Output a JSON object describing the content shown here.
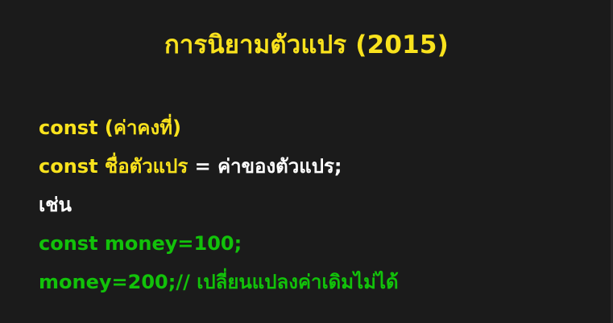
{
  "slide": {
    "title": "การนิยามตัวแปร (2015)",
    "lines": [
      {
        "keyword": "const (ค่าคงที่)"
      },
      {
        "keyword": "const ชื่อตัวแปร",
        "rest": " = ค่าของตัวแปร;"
      },
      {
        "text": "เช่น"
      },
      {
        "code": "const money=100;"
      },
      {
        "code": "money=200;// เปลี่ยนแปลงค่าเดิมไม่ได้"
      }
    ]
  },
  "colors": {
    "background": "#1b1b1b",
    "title": "#f9e21d",
    "keyword": "#f9e21d",
    "text": "#ffffff",
    "code": "#12c20a"
  }
}
